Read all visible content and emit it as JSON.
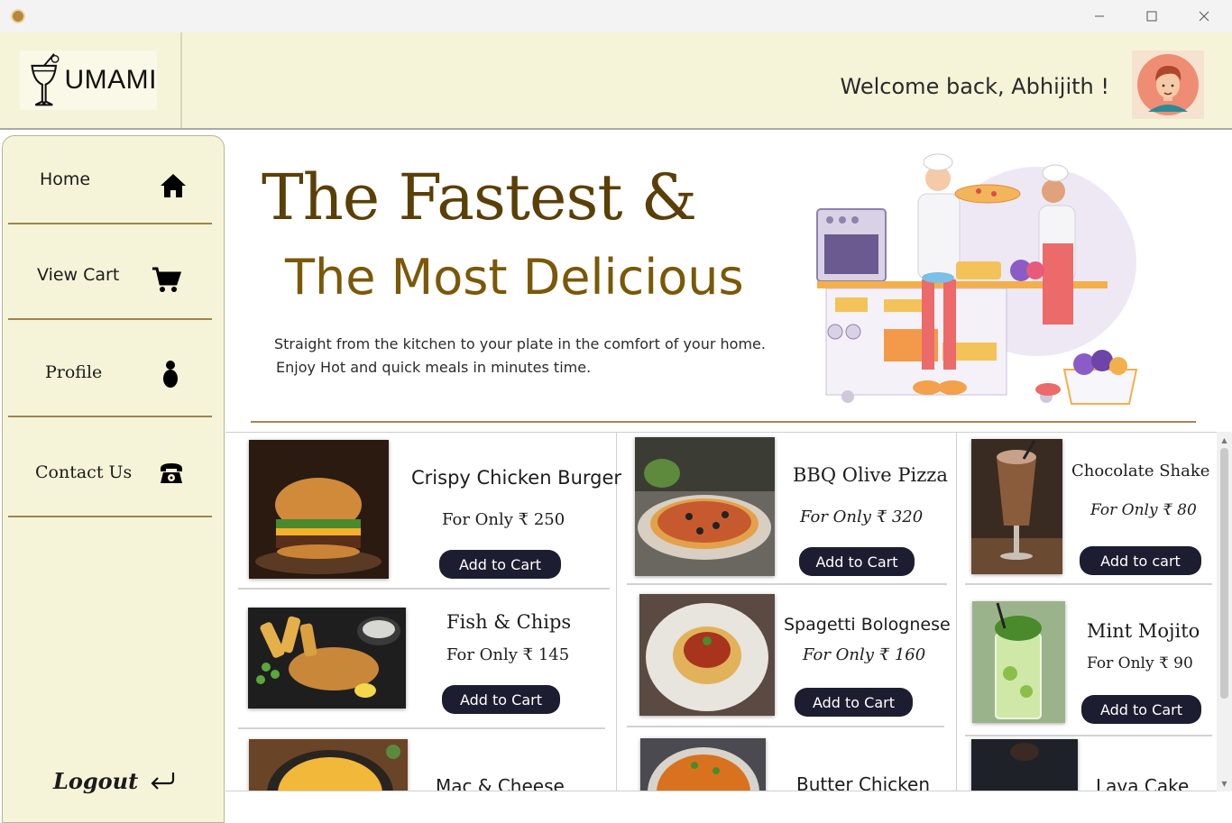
{
  "window": {
    "min_icon": "minimize-icon",
    "max_icon": "maximize-icon",
    "close_icon": "close-icon"
  },
  "header": {
    "logo_text": "UMAMI",
    "welcome": "Welcome back, Abhijith !"
  },
  "sidebar": {
    "items": [
      {
        "label": "Home",
        "icon": "home-icon"
      },
      {
        "label": "View Cart",
        "icon": "cart-icon"
      },
      {
        "label": "Profile",
        "icon": "person-icon"
      },
      {
        "label": "Contact Us",
        "icon": "phone-icon"
      }
    ],
    "logout": "Logout"
  },
  "hero": {
    "title_line1": "The Fastest &",
    "title_line2": "The Most Delicious",
    "text_line1": "Straight from the kitchen to your plate in the comfort of your home.",
    "text_line2": "Enjoy Hot and quick meals in minutes time."
  },
  "menu": {
    "items": [
      {
        "name": "Crispy Chicken Burger",
        "price": "For Only ₹ 250",
        "button": "Add to Cart"
      },
      {
        "name": "BBQ Olive Pizza",
        "price": "For Only ₹ 320",
        "button": "Add to Cart"
      },
      {
        "name": "Chocolate Shake",
        "price": "For Only ₹ 80",
        "button": "Add to cart"
      },
      {
        "name": "Fish & Chips",
        "price": "For Only ₹ 145",
        "button": "Add to Cart"
      },
      {
        "name": "Spagetti Bolognese",
        "price": "For Only ₹ 160",
        "button": "Add to Cart"
      },
      {
        "name": "Mint Mojito",
        "price": "For Only ₹ 90",
        "button": "Add to Cart"
      },
      {
        "name": "Mac & Cheese"
      },
      {
        "name": "Butter Chicken"
      },
      {
        "name": "Lava Cake"
      }
    ]
  },
  "colors": {
    "header_bg": "#f6f4d8",
    "title_brown": "#5a3f06",
    "button_navy": "#1c1d30",
    "divider_gold": "#9c8550"
  }
}
